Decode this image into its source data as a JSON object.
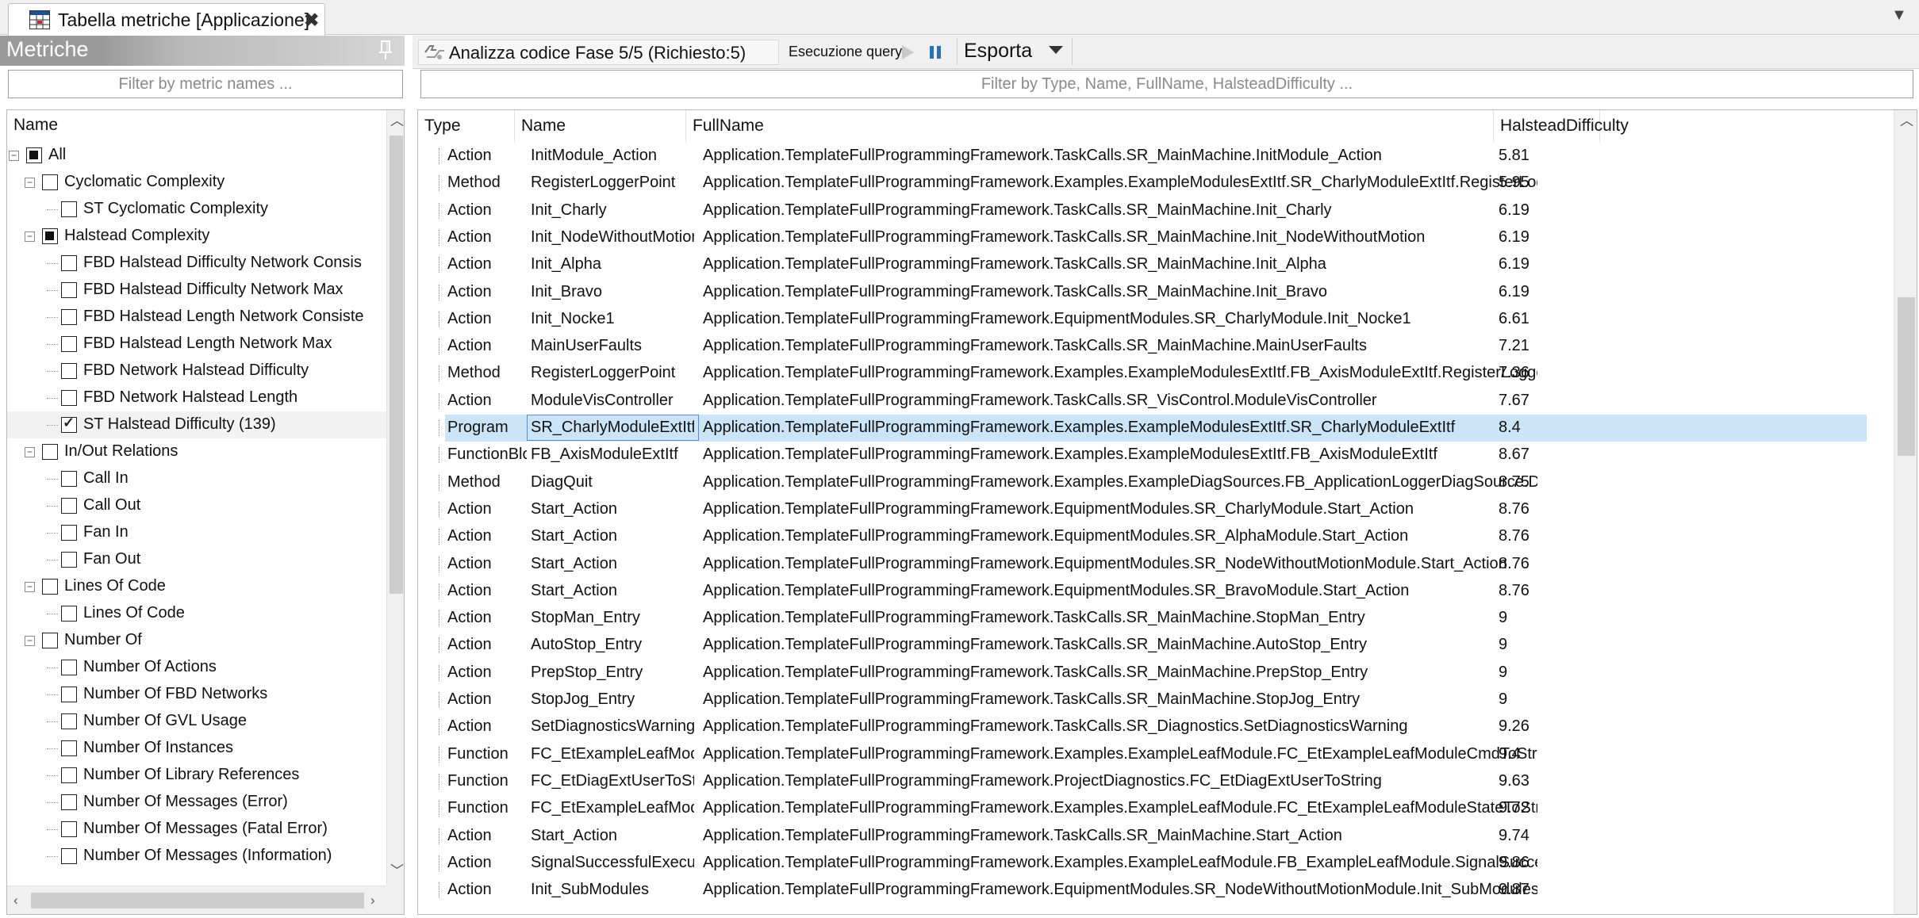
{
  "doc_tab": {
    "title": "Tabella metriche [Applicazione]",
    "close": "✖"
  },
  "left_panel": {
    "title": "Metriche",
    "filter_placeholder": "Filter by metric names ...",
    "tree_header": "Name",
    "tree": [
      {
        "label": "All",
        "level": 0,
        "expander": true,
        "state": "partial"
      },
      {
        "label": "Cyclomatic Complexity",
        "level": 1,
        "expander": true,
        "state": "unchecked"
      },
      {
        "label": "ST Cyclomatic Complexity",
        "level": 2,
        "expander": false,
        "state": "unchecked"
      },
      {
        "label": "Halstead Complexity",
        "level": 1,
        "expander": true,
        "state": "partial"
      },
      {
        "label": "FBD Halstead Difficulty Network Consis",
        "level": 2,
        "expander": false,
        "state": "unchecked"
      },
      {
        "label": "FBD Halstead Difficulty Network Max",
        "level": 2,
        "expander": false,
        "state": "unchecked"
      },
      {
        "label": "FBD Halstead Length Network Consiste",
        "level": 2,
        "expander": false,
        "state": "unchecked"
      },
      {
        "label": "FBD Halstead Length Network Max",
        "level": 2,
        "expander": false,
        "state": "unchecked"
      },
      {
        "label": "FBD Network Halstead Difficulty",
        "level": 2,
        "expander": false,
        "state": "unchecked"
      },
      {
        "label": "FBD Network Halstead Length",
        "level": 2,
        "expander": false,
        "state": "unchecked"
      },
      {
        "label": "ST Halstead Difficulty (139)",
        "level": 2,
        "expander": false,
        "state": "checked",
        "selected": true
      },
      {
        "label": "In/Out Relations",
        "level": 1,
        "expander": true,
        "state": "unchecked"
      },
      {
        "label": "Call In",
        "level": 2,
        "expander": false,
        "state": "unchecked"
      },
      {
        "label": "Call Out",
        "level": 2,
        "expander": false,
        "state": "unchecked"
      },
      {
        "label": "Fan In",
        "level": 2,
        "expander": false,
        "state": "unchecked"
      },
      {
        "label": "Fan Out",
        "level": 2,
        "expander": false,
        "state": "unchecked"
      },
      {
        "label": "Lines Of Code",
        "level": 1,
        "expander": true,
        "state": "unchecked"
      },
      {
        "label": "Lines Of Code",
        "level": 2,
        "expander": false,
        "state": "unchecked"
      },
      {
        "label": "Number Of",
        "level": 1,
        "expander": true,
        "state": "unchecked"
      },
      {
        "label": "Number Of Actions",
        "level": 2,
        "expander": false,
        "state": "unchecked"
      },
      {
        "label": "Number Of FBD Networks",
        "level": 2,
        "expander": false,
        "state": "unchecked"
      },
      {
        "label": "Number Of GVL Usage",
        "level": 2,
        "expander": false,
        "state": "unchecked"
      },
      {
        "label": "Number Of Instances",
        "level": 2,
        "expander": false,
        "state": "unchecked"
      },
      {
        "label": "Number Of Library References",
        "level": 2,
        "expander": false,
        "state": "unchecked"
      },
      {
        "label": "Number Of Messages (Error)",
        "level": 2,
        "expander": false,
        "state": "unchecked"
      },
      {
        "label": "Number Of Messages (Fatal Error)",
        "level": 2,
        "expander": false,
        "state": "unchecked"
      },
      {
        "label": "Number Of Messages (Information)",
        "level": 2,
        "expander": false,
        "state": "unchecked"
      }
    ]
  },
  "toolbar": {
    "status": "Analizza codice Fase 5/5 (Richiesto:5)",
    "query_label": "Esecuzione query:",
    "export_label": "Esporta"
  },
  "grid": {
    "filter_placeholder": "Filter by Type, Name, FullName, HalsteadDifficulty ...",
    "columns": [
      "Type",
      "Name",
      "FullName",
      "HalsteadDifficulty"
    ],
    "rows": [
      {
        "type": "Action",
        "name": "InitModule_Action",
        "fullname": "Application.TemplateFullProgrammingFramework.TaskCalls.SR_MainMachine.InitModule_Action",
        "hd": "5.81"
      },
      {
        "type": "Method",
        "name": "RegisterLoggerPoint",
        "fullname": "Application.TemplateFullProgrammingFramework.Examples.ExampleModulesExtItf.SR_CharlyModuleExtItf.RegisterLogg...",
        "hd": "5.95"
      },
      {
        "type": "Action",
        "name": "Init_Charly",
        "fullname": "Application.TemplateFullProgrammingFramework.TaskCalls.SR_MainMachine.Init_Charly",
        "hd": "6.19"
      },
      {
        "type": "Action",
        "name": "Init_NodeWithoutMotion",
        "fullname": "Application.TemplateFullProgrammingFramework.TaskCalls.SR_MainMachine.Init_NodeWithoutMotion",
        "hd": "6.19"
      },
      {
        "type": "Action",
        "name": "Init_Alpha",
        "fullname": "Application.TemplateFullProgrammingFramework.TaskCalls.SR_MainMachine.Init_Alpha",
        "hd": "6.19"
      },
      {
        "type": "Action",
        "name": "Init_Bravo",
        "fullname": "Application.TemplateFullProgrammingFramework.TaskCalls.SR_MainMachine.Init_Bravo",
        "hd": "6.19"
      },
      {
        "type": "Action",
        "name": "Init_Nocke1",
        "fullname": "Application.TemplateFullProgrammingFramework.EquipmentModules.SR_CharlyModule.Init_Nocke1",
        "hd": "6.61"
      },
      {
        "type": "Action",
        "name": "MainUserFaults",
        "fullname": "Application.TemplateFullProgrammingFramework.TaskCalls.SR_MainMachine.MainUserFaults",
        "hd": "7.21"
      },
      {
        "type": "Method",
        "name": "RegisterLoggerPoint",
        "fullname": "Application.TemplateFullProgrammingFramework.Examples.ExampleModulesExtItf.FB_AxisModuleExtItf.RegisterLogger...",
        "hd": "7.36"
      },
      {
        "type": "Action",
        "name": "ModuleVisController",
        "fullname": "Application.TemplateFullProgrammingFramework.TaskCalls.SR_VisControl.ModuleVisController",
        "hd": "7.67"
      },
      {
        "type": "Program",
        "name": "SR_CharlyModuleExtItf",
        "fullname": "Application.TemplateFullProgrammingFramework.Examples.ExampleModulesExtItf.SR_CharlyModuleExtItf",
        "hd": "8.4",
        "selected": true
      },
      {
        "type": "FunctionBlock",
        "name": "FB_AxisModuleExtItf",
        "fullname": "Application.TemplateFullProgrammingFramework.Examples.ExampleModulesExtItf.FB_AxisModuleExtItf",
        "hd": "8.67"
      },
      {
        "type": "Method",
        "name": "DiagQuit",
        "fullname": "Application.TemplateFullProgrammingFramework.Examples.ExampleDiagSources.FB_ApplicationLoggerDiagSource.Diag...",
        "hd": "8.75"
      },
      {
        "type": "Action",
        "name": "Start_Action",
        "fullname": "Application.TemplateFullProgrammingFramework.EquipmentModules.SR_CharlyModule.Start_Action",
        "hd": "8.76"
      },
      {
        "type": "Action",
        "name": "Start_Action",
        "fullname": "Application.TemplateFullProgrammingFramework.EquipmentModules.SR_AlphaModule.Start_Action",
        "hd": "8.76"
      },
      {
        "type": "Action",
        "name": "Start_Action",
        "fullname": "Application.TemplateFullProgrammingFramework.EquipmentModules.SR_NodeWithoutMotionModule.Start_Action",
        "hd": "8.76"
      },
      {
        "type": "Action",
        "name": "Start_Action",
        "fullname": "Application.TemplateFullProgrammingFramework.EquipmentModules.SR_BravoModule.Start_Action",
        "hd": "8.76"
      },
      {
        "type": "Action",
        "name": "StopMan_Entry",
        "fullname": "Application.TemplateFullProgrammingFramework.TaskCalls.SR_MainMachine.StopMan_Entry",
        "hd": "9"
      },
      {
        "type": "Action",
        "name": "AutoStop_Entry",
        "fullname": "Application.TemplateFullProgrammingFramework.TaskCalls.SR_MainMachine.AutoStop_Entry",
        "hd": "9"
      },
      {
        "type": "Action",
        "name": "PrepStop_Entry",
        "fullname": "Application.TemplateFullProgrammingFramework.TaskCalls.SR_MainMachine.PrepStop_Entry",
        "hd": "9"
      },
      {
        "type": "Action",
        "name": "StopJog_Entry",
        "fullname": "Application.TemplateFullProgrammingFramework.TaskCalls.SR_MainMachine.StopJog_Entry",
        "hd": "9"
      },
      {
        "type": "Action",
        "name": "SetDiagnosticsWarning",
        "fullname": "Application.TemplateFullProgrammingFramework.TaskCalls.SR_Diagnostics.SetDiagnosticsWarning",
        "hd": "9.26"
      },
      {
        "type": "Function",
        "name": "FC_EtExampleLeafModuleCmdToS...",
        "fullname": "Application.TemplateFullProgrammingFramework.Examples.ExampleLeafModule.FC_EtExampleLeafModuleCmdToString",
        "hd": "9.4"
      },
      {
        "type": "Function",
        "name": "FC_EtDiagExtUserToString",
        "fullname": "Application.TemplateFullProgrammingFramework.ProjectDiagnostics.FC_EtDiagExtUserToString",
        "hd": "9.63"
      },
      {
        "type": "Function",
        "name": "FC_EtExampleLeafModuleStateTo...",
        "fullname": "Application.TemplateFullProgrammingFramework.Examples.ExampleLeafModule.FC_EtExampleLeafModuleStateToString",
        "hd": "9.72"
      },
      {
        "type": "Action",
        "name": "Start_Action",
        "fullname": "Application.TemplateFullProgrammingFramework.TaskCalls.SR_MainMachine.Start_Action",
        "hd": "9.74"
      },
      {
        "type": "Action",
        "name": "SignalSuccessfulExecution",
        "fullname": "Application.TemplateFullProgrammingFramework.Examples.ExampleLeafModule.FB_ExampleLeafModule.SignalSuccessf...",
        "hd": "9.86"
      },
      {
        "type": "Action",
        "name": "Init_SubModules",
        "fullname": "Application.TemplateFullProgrammingFramework.EquipmentModules.SR_NodeWithoutMotionModule.Init_SubModules",
        "hd": "9.87"
      }
    ]
  },
  "colors": {
    "selection": "#cce4f7",
    "selection_border": "#5a8fcc",
    "panel_header": "#9a9a9a",
    "toolbar": "#f0f0f0"
  }
}
